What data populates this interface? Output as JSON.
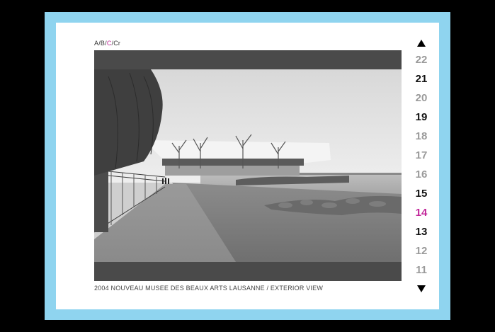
{
  "breadcrumb": {
    "items": [
      {
        "label": "A",
        "active": false
      },
      {
        "label": "B",
        "active": false
      },
      {
        "label": "C",
        "active": true
      },
      {
        "label": "Cr",
        "active": false
      }
    ],
    "separator": "/"
  },
  "viewer": {
    "caption": "2004 NOUVEAU MUSEE DES BEAUX ARTS LAUSANNE / EXTERIOR VIEW",
    "image": "photo-lakeshore-museum"
  },
  "nav": {
    "up_icon": "triangle-up-icon",
    "down_icon": "triangle-down-icon",
    "numbers": [
      {
        "label": "22",
        "style": "light"
      },
      {
        "label": "21",
        "style": "dark"
      },
      {
        "label": "20",
        "style": "light"
      },
      {
        "label": "19",
        "style": "dark"
      },
      {
        "label": "18",
        "style": "light"
      },
      {
        "label": "17",
        "style": "light"
      },
      {
        "label": "16",
        "style": "light"
      },
      {
        "label": "15",
        "style": "dark"
      },
      {
        "label": "14",
        "style": "active"
      },
      {
        "label": "13",
        "style": "dark"
      },
      {
        "label": "12",
        "style": "light"
      },
      {
        "label": "11",
        "style": "light"
      }
    ]
  },
  "colors": {
    "frame": "#8fd4ef",
    "accent": "#c2279a",
    "background": "#000000"
  }
}
